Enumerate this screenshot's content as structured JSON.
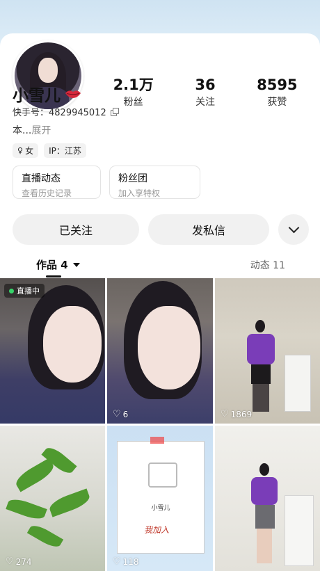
{
  "profile": {
    "name": "小雪儿",
    "kuaishou_id": "快手号：4829945012",
    "bio": "本...",
    "bio_expand": "展开",
    "gender_tag": "女",
    "ip_tag": "IP：江苏"
  },
  "stats": [
    {
      "value": "2.1万",
      "label": "粉丝"
    },
    {
      "value": "36",
      "label": "关注"
    },
    {
      "value": "8595",
      "label": "获赞"
    }
  ],
  "entries": [
    {
      "title": "直播动态",
      "subtitle": "查看历史记录"
    },
    {
      "title": "粉丝团",
      "subtitle": "加入享特权"
    }
  ],
  "actions": {
    "follow": "已关注",
    "message": "发私信"
  },
  "tabs": {
    "works": "作品 4",
    "dynamics": "动态 11"
  },
  "grid": [
    {
      "badge": "直播中",
      "likes": ""
    },
    {
      "badge": "",
      "likes": "6"
    },
    {
      "badge": "",
      "likes": "1869"
    },
    {
      "badge": "",
      "likes": "274"
    },
    {
      "badge": "",
      "likes": "118",
      "card_name": "小雪儿",
      "card_text": "我加入"
    },
    {
      "badge": "",
      "likes": ""
    }
  ]
}
